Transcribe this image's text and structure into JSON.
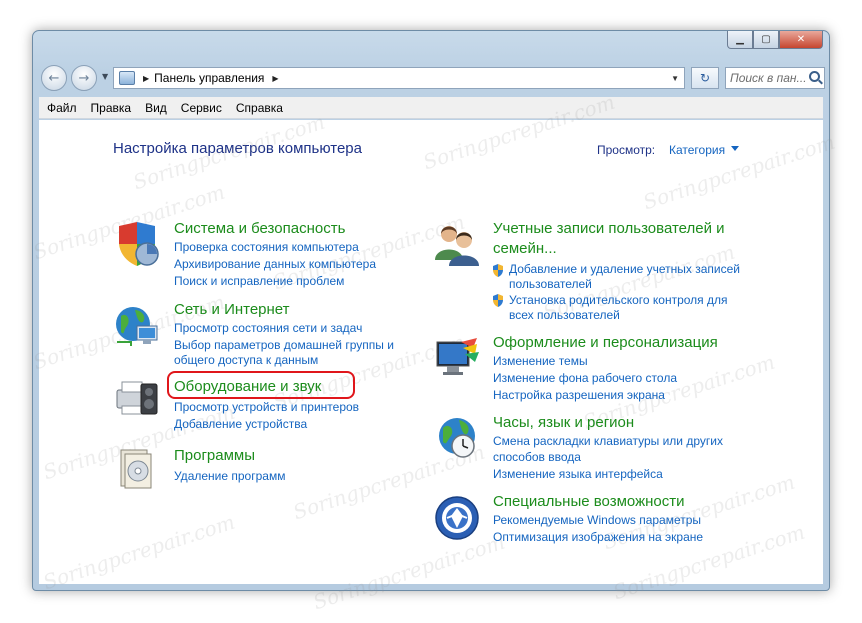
{
  "window": {
    "minimize_glyph": "▁",
    "maximize_glyph": "▢",
    "close_glyph": "✕"
  },
  "nav": {
    "back_glyph": "←",
    "forward_glyph": "→",
    "breadcrumb": "Панель управления",
    "breadcrumb_sep": "▶",
    "dropdown_glyph": "▼",
    "refresh_glyph": "↻",
    "search_placeholder": "Поиск в пан..."
  },
  "menu": {
    "items": [
      "Файл",
      "Правка",
      "Вид",
      "Сервис",
      "Справка"
    ]
  },
  "header": {
    "title": "Настройка параметров компьютера",
    "view_label": "Просмотр:",
    "view_value": "Категория"
  },
  "categories": {
    "system": {
      "title": "Система и безопасность",
      "links": [
        "Проверка состояния компьютера",
        "Архивирование данных компьютера",
        "Поиск и исправление проблем"
      ]
    },
    "network": {
      "title": "Сеть и Интернет",
      "links": [
        "Просмотр состояния сети и задач",
        "Выбор параметров домашней группы и",
        "общего доступа к данным"
      ]
    },
    "hardware": {
      "title": "Оборудование и звук",
      "links": [
        "Просмотр устройств и принтеров",
        "Добавление устройства"
      ]
    },
    "programs": {
      "title": "Программы",
      "links": [
        "Удаление программ"
      ]
    },
    "accounts": {
      "title_line1": "Учетные записи пользователей и",
      "title_line2": "семейн...",
      "links": [
        "Добавление и удаление учетных записей",
        "пользователей",
        "Установка родительского контроля для",
        "всех пользователей"
      ]
    },
    "appearance": {
      "title": "Оформление и персонализация",
      "links": [
        "Изменение темы",
        "Изменение фона рабочего стола",
        "Настройка разрешения экрана"
      ]
    },
    "clock": {
      "title": "Часы, язык и регион",
      "links": [
        "Смена раскладки клавиатуры или других",
        "способов ввода",
        "Изменение языка интерфейса"
      ]
    },
    "access": {
      "title": "Специальные возможности",
      "links": [
        "Рекомендуемые Windows параметры",
        "Оптимизация изображения на экране"
      ]
    }
  },
  "watermark": "Soringpcrepair.com",
  "colors": {
    "category_title": "#1c8c1c",
    "link": "#1565c0",
    "heading": "#1e3287",
    "highlight": "#e0161b"
  }
}
